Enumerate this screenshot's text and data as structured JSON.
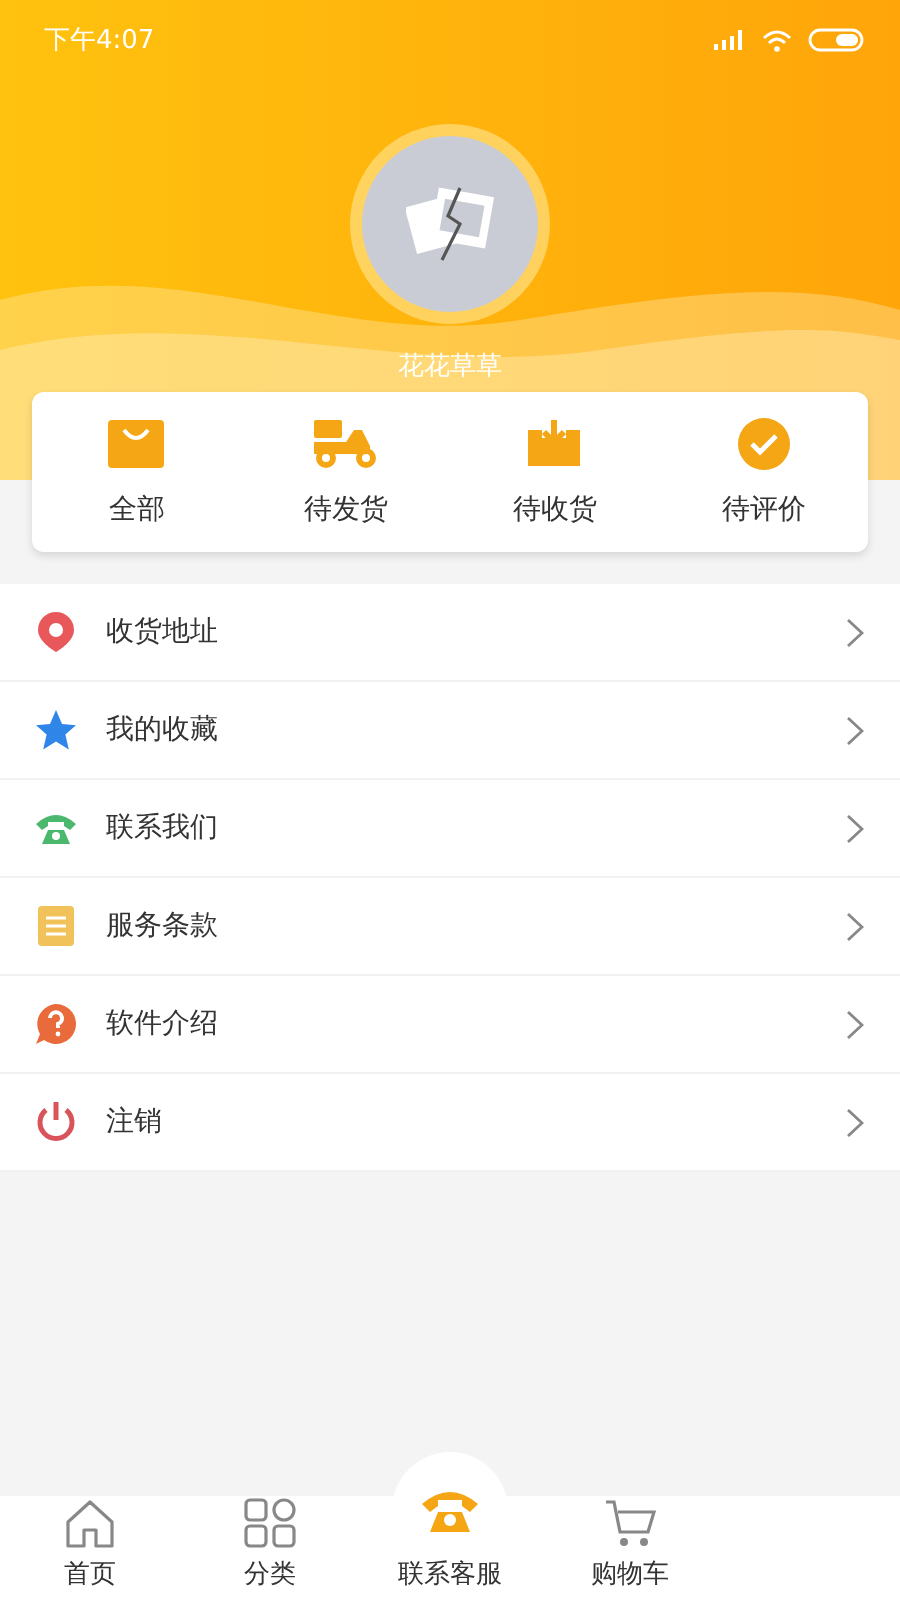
{
  "status_bar": {
    "time": "下午4:07"
  },
  "profile": {
    "name": "花花草草"
  },
  "order_tabs": [
    {
      "kind": "bag",
      "label": "全部"
    },
    {
      "kind": "scooter",
      "label": "待发货"
    },
    {
      "kind": "inbox",
      "label": "待收货"
    },
    {
      "kind": "check",
      "label": "待评价"
    }
  ],
  "menu": [
    {
      "kind": "location",
      "label": "收货地址",
      "color": "#e8585b"
    },
    {
      "kind": "star",
      "label": "我的收藏",
      "color": "#2f86e8"
    },
    {
      "kind": "phone",
      "label": "联系我们",
      "color": "#4cb86e"
    },
    {
      "kind": "doc",
      "label": "服务条款",
      "color": "#f2c25a"
    },
    {
      "kind": "help",
      "label": "软件介绍",
      "color": "#e96a3a"
    },
    {
      "kind": "power",
      "label": "注销",
      "color": "#d9535a"
    }
  ],
  "tab_bar": [
    {
      "kind": "home",
      "label": "首页"
    },
    {
      "kind": "grid",
      "label": "分类"
    },
    {
      "kind": "center",
      "label": "联系客服"
    },
    {
      "kind": "cart",
      "label": "购物车"
    }
  ]
}
